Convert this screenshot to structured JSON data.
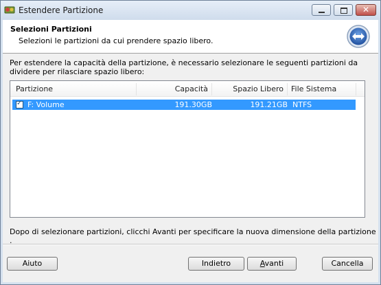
{
  "window": {
    "title": "Estendere Partizione"
  },
  "header": {
    "title": "Selezioni Partizioni",
    "subtitle": "Selezioni le partizioni da cui prendere spazio libero."
  },
  "description": "Per estendere la capacità della partizione, è necessario selezionare le seguenti partizioni da dividere per rilasciare spazio libero:",
  "table": {
    "columns": [
      "Partizione",
      "Capacità",
      "Spazio Libero",
      "File Sistema"
    ],
    "rows": [
      {
        "checked": true,
        "partition": "F: Volume",
        "capacity": "191.30GB",
        "free_space": "191.21GB",
        "file_system": "NTFS"
      }
    ]
  },
  "footer_note": "Dopo di selezionare partizioni, clicchi Avanti per specificare la nuova dimensione della partizione .",
  "buttons": {
    "help": "Aiuto",
    "back": "Indietro",
    "next_accel": "A",
    "next_rest": "vanti",
    "cancel": "Cancella"
  },
  "colors": {
    "selection": "#3399ff",
    "title_bar": "#d5e1ef"
  }
}
